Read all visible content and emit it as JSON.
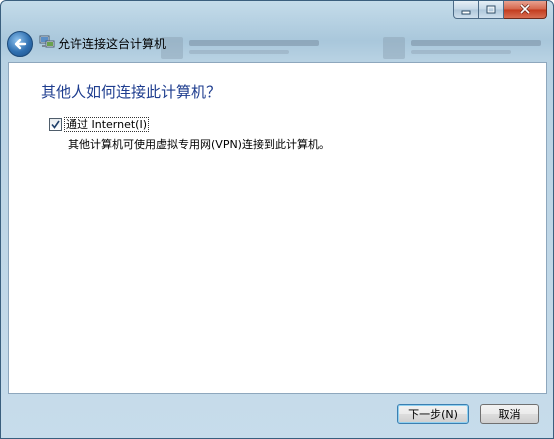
{
  "window": {
    "title": "允许连接这台计算机",
    "controls": {
      "minimize": "minimize",
      "maximize": "maximize",
      "close": "close"
    }
  },
  "content": {
    "heading": "其他人如何连接此计算机？",
    "option": {
      "label": "通过 Internet(I)",
      "checked": true,
      "description": "其他计算机可使用虚拟专用网(VPN)连接到此计算机。"
    }
  },
  "footer": {
    "next_label": "下一步(N)",
    "cancel_label": "取消"
  },
  "colors": {
    "heading": "#1e3d8f",
    "frame": "#b8d2e3",
    "close_button": "#c23a1d"
  }
}
